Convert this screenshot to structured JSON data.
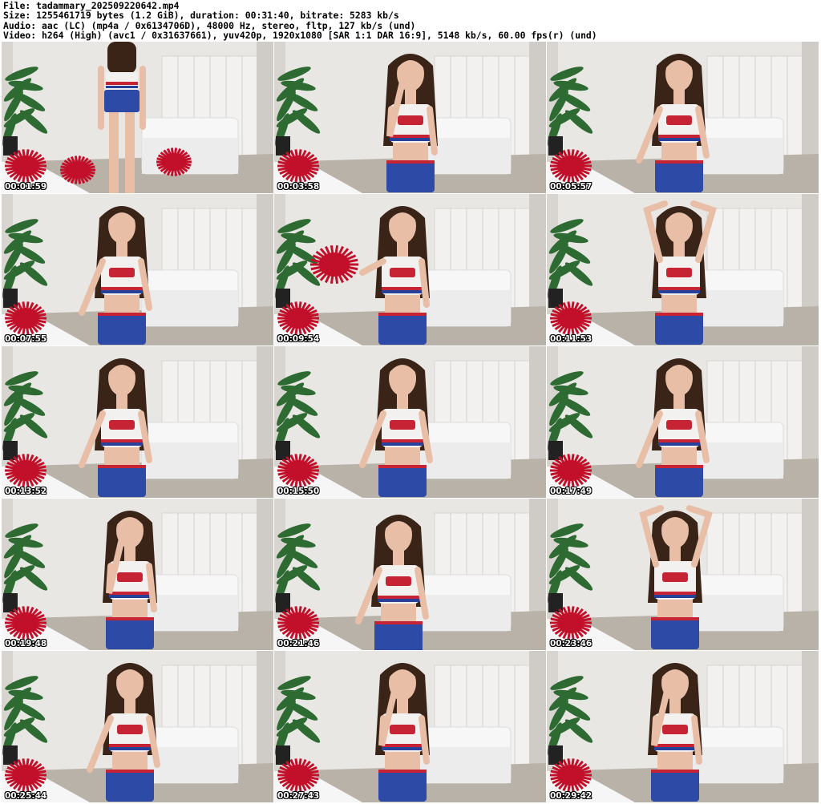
{
  "header": {
    "file_line": "File: tadammary_202509220642.mp4",
    "size_line": "Size: 1255461719 bytes (1.2 GiB), duration: 00:31:40, bitrate: 5283 kb/s",
    "audio_line": "Audio: aac (LC) (mp4a / 0x6134706D), 48000 Hz, stereo, fltp, 127 kb/s (und)",
    "video_line": "Video: h264 (High) (avc1 / 0x31637661), yuv420p, 1920x1080 [SAR 1:1 DAR 16:9], 5148 kb/s, 60.00 fps(r) (und)"
  },
  "thumbnails": [
    {
      "timestamp": "00:01:59",
      "pose": "back-view-pompoms"
    },
    {
      "timestamp": "00:03:58",
      "pose": "hand-to-face"
    },
    {
      "timestamp": "00:05:57",
      "pose": "standing-front"
    },
    {
      "timestamp": "00:07:55",
      "pose": "seated-looking-down"
    },
    {
      "timestamp": "00:09:54",
      "pose": "holding-pompom"
    },
    {
      "timestamp": "00:11:53",
      "pose": "arms-raised"
    },
    {
      "timestamp": "00:13:52",
      "pose": "seated-looking-down"
    },
    {
      "timestamp": "00:15:50",
      "pose": "seated-smiling"
    },
    {
      "timestamp": "00:17:49",
      "pose": "seated-front"
    },
    {
      "timestamp": "00:19:48",
      "pose": "hand-to-face"
    },
    {
      "timestamp": "00:21:46",
      "pose": "close-up"
    },
    {
      "timestamp": "00:23:46",
      "pose": "hand-behind-head"
    },
    {
      "timestamp": "00:25:44",
      "pose": "seated-front"
    },
    {
      "timestamp": "00:27:43",
      "pose": "hand-to-face"
    },
    {
      "timestamp": "00:29:42",
      "pose": "hand-at-chin"
    }
  ],
  "colors": {
    "wall": "#e9e7e4",
    "wardrobe": "#f2f1ef",
    "bed": "#f7f7f7",
    "floor": "#b9b2a8",
    "plant": "#2e6b33",
    "pompom": "#c3102a",
    "hair": "#3a2418",
    "skin": "#e8bfa6",
    "top": "#f3f1f0",
    "stripe_red": "#c62435",
    "stripe_blue": "#27409a",
    "skirt": "#2c4aa6"
  }
}
